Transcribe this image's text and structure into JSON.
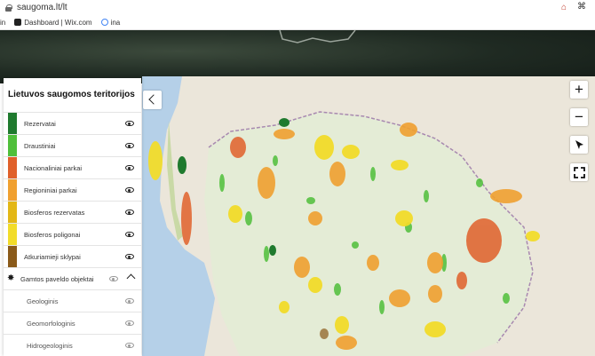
{
  "browser": {
    "url": "saugoma.lt/lt",
    "bookmarks": [
      {
        "label": "in",
        "icon": "linkedin-icon",
        "color": "#0a66c2"
      },
      {
        "label": "Dashboard | Wix.com",
        "icon": "wix-icon",
        "color": "#222222"
      },
      {
        "label": "ina",
        "icon": "google-icon",
        "color": "#4285f4"
      }
    ]
  },
  "panel": {
    "title": "Lietuvos saugomos teritorijos",
    "layers": [
      {
        "label": "Rezervatai",
        "color": "#1f7a2e"
      },
      {
        "label": "Draustiniai",
        "color": "#4fbf3a"
      },
      {
        "label": "Nacionaliniai parkai",
        "color": "#e0602a"
      },
      {
        "label": "Regioniniai parkai",
        "color": "#f0a030"
      },
      {
        "label": "Biosferos rezervatas",
        "color": "#e3b716"
      },
      {
        "label": "Biosferos poligonai",
        "color": "#f2dc2a"
      },
      {
        "label": "Atkuriamieji sklypai",
        "color": "#8a5a1a"
      }
    ],
    "heritage": {
      "label": "Gamtos paveldo objektai"
    },
    "heritage_items": [
      {
        "label": "Geologinis"
      },
      {
        "label": "Geomorfologinis"
      },
      {
        "label": "Hidrogeologinis"
      }
    ]
  },
  "map_controls": {
    "zoom_in": "+",
    "zoom_out": "−"
  }
}
